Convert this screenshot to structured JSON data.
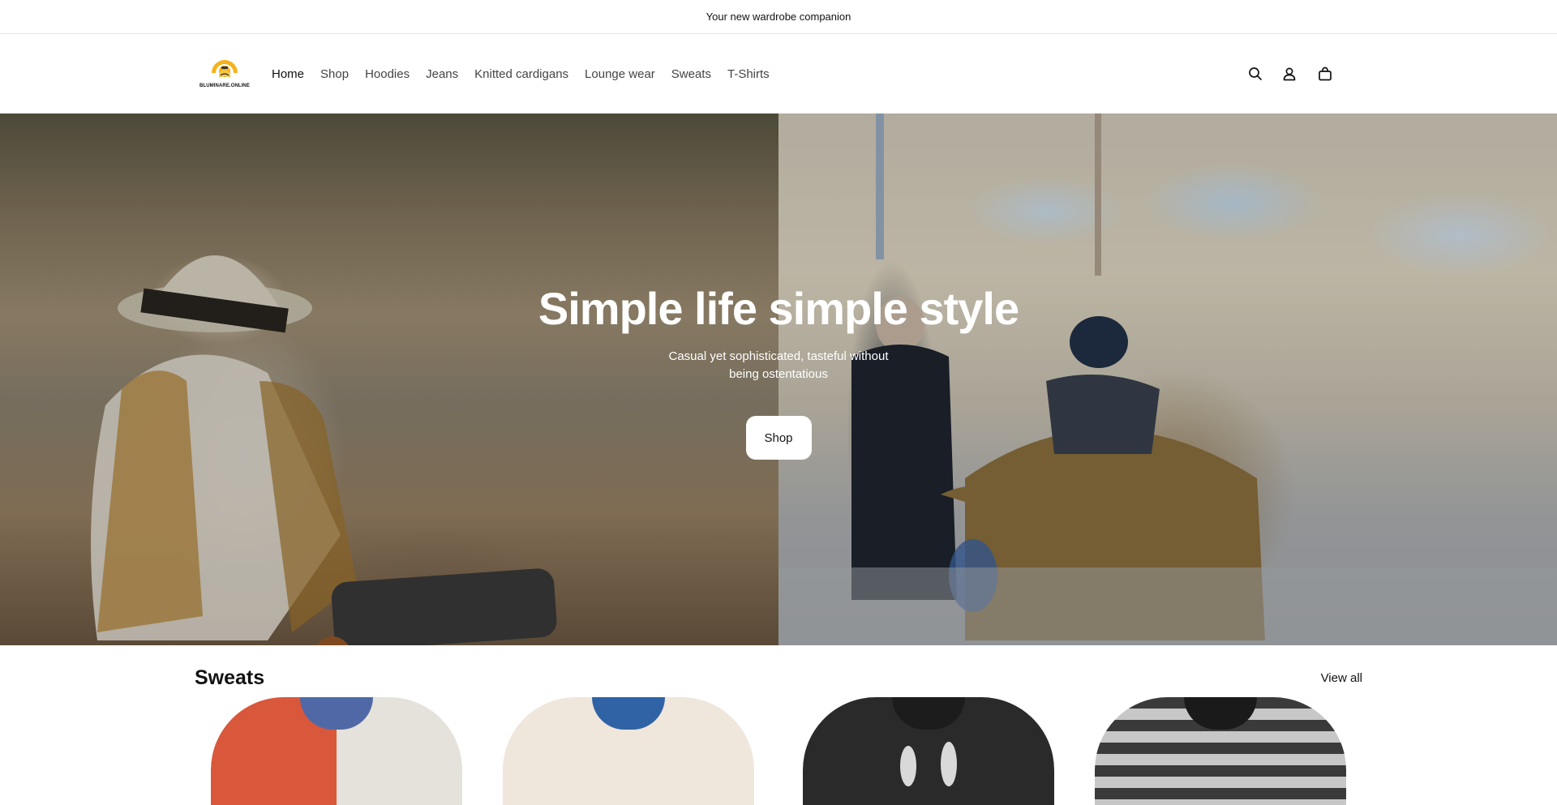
{
  "announcement": "Your new wardrobe companion",
  "brand": {
    "logo_text": "BLUMINARE.ONLINE",
    "accent": "#F5B21B"
  },
  "nav": {
    "items": [
      {
        "label": "Home",
        "active": true
      },
      {
        "label": "Shop"
      },
      {
        "label": "Hoodies"
      },
      {
        "label": "Jeans"
      },
      {
        "label": "Knitted cardigans"
      },
      {
        "label": "Lounge wear"
      },
      {
        "label": "Sweats"
      },
      {
        "label": "T-Shirts"
      }
    ]
  },
  "header_icons": [
    "search-icon",
    "account-icon",
    "cart-icon"
  ],
  "hero": {
    "title": "Simple life simple style",
    "subtitle": "Casual yet sophisticated, tasteful without being ostentatious",
    "button_label": "Shop"
  },
  "collection": {
    "title": "Sweats",
    "view_all_label": "View all",
    "products": [
      {
        "body_color": "#E4E2DA",
        "accent_color": "#D9573A",
        "collar_color": "#5069A6"
      },
      {
        "body_color": "#EFE6DC",
        "accent_color": "#EFE6DC",
        "collar_color": "#2F63A5"
      },
      {
        "body_color": "#2A2A2A",
        "accent_color": "#2A2A2A",
        "collar_color": "#1C1C1C"
      },
      {
        "body_color": "#4A4A4A",
        "accent_color": "#C7C7C7",
        "collar_color": "#1A1A1A"
      }
    ]
  }
}
